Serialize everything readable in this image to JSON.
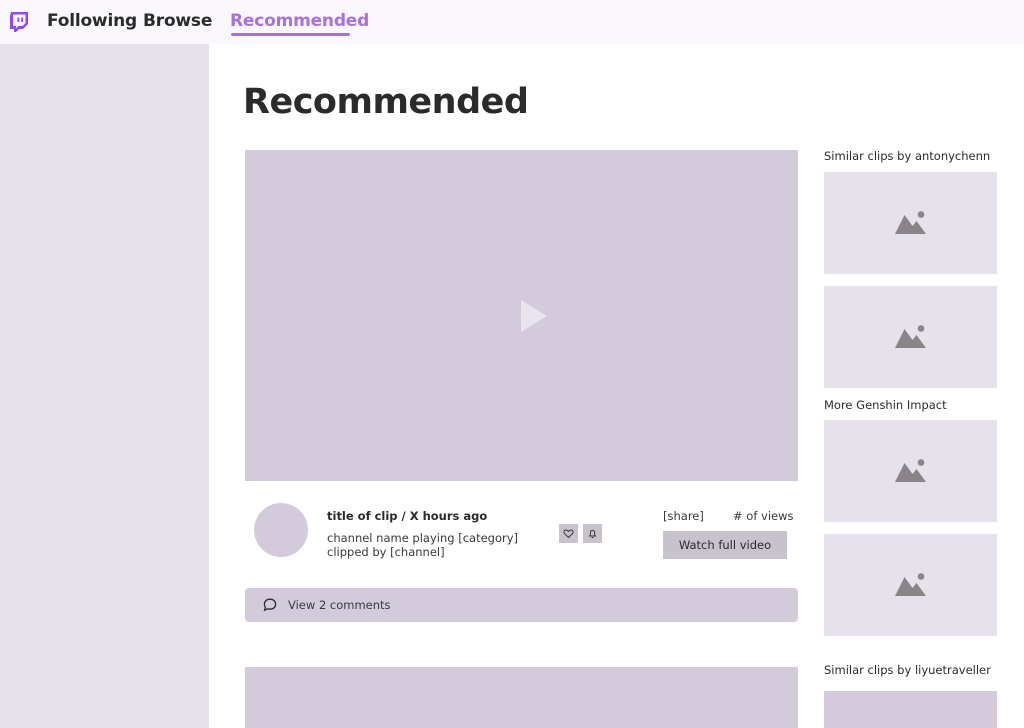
{
  "nav": {
    "items": [
      {
        "label": "Following"
      },
      {
        "label": "Browse"
      },
      {
        "label": "Recommended",
        "active": true
      }
    ],
    "logo_icon": "twitch-logo-icon",
    "accent_color": "#a970e0"
  },
  "page": {
    "title": "Recommended"
  },
  "clip": {
    "title": "title of clip / X hours ago",
    "channel_line": "channel name playing [category]",
    "clipped_line": "clipped by [channel]",
    "share_label": "[share]",
    "views_label": "# of views",
    "watch_button_label": "Watch full video",
    "like_icon": "heart-icon",
    "notify_icon": "bell-icon"
  },
  "comments": {
    "label": "View 2 comments",
    "icon": "speech-bubble-icon"
  },
  "sidebar_right": {
    "sections": [
      {
        "heading": "Similar clips by antonychenn",
        "thumb_count": 2
      },
      {
        "heading": "More Genshin Impact",
        "thumb_count": 2
      },
      {
        "heading": "Similar clips by liyuetraveller",
        "thumb_count": 1
      }
    ],
    "thumb_icon": "image-placeholder-icon"
  }
}
